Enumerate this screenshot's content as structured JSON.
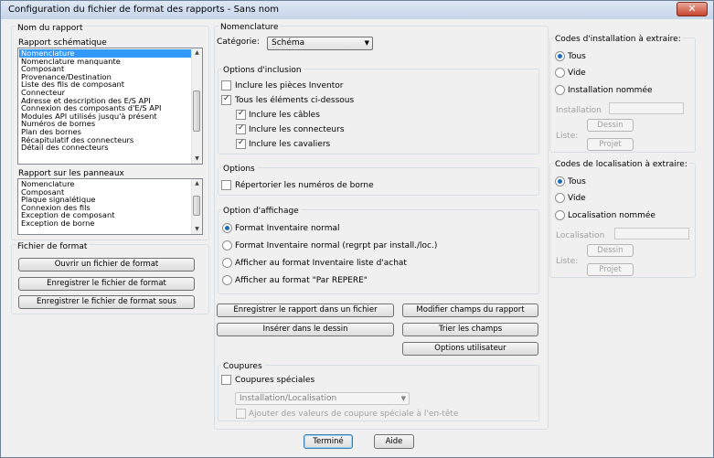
{
  "window": {
    "title": "Configuration du fichier de format des rapports - Sans nom",
    "close_glyph": "✕"
  },
  "left": {
    "name_group_label": "Nom du rapport",
    "schematic_label": "Rapport schématique",
    "schematic_items": [
      "Nomenclature",
      "Nomenclature manquante",
      "Composant",
      "Provenance/Destination",
      "Liste des fils de composant",
      "Connecteur",
      "Adresse et description des E/S API",
      "Connexion des composants d'E/S API",
      "Modules API utilisés jusqu'à présent",
      "Numéros de bornes",
      "Plan des bornes",
      "Récapitulatif des connecteurs",
      "Détail des connecteurs"
    ],
    "schematic_selected": "Nomenclature",
    "panel_label": "Rapport sur les panneaux",
    "panel_items": [
      "Nomenclature",
      "Composant",
      "Plaque signalétique",
      "Connexion des fils",
      "Exception de composant",
      "Exception de borne"
    ],
    "format_group_label": "Fichier de format",
    "open_button": "Ouvrir un fichier de format",
    "save_button": "Enregistrer le fichier de format",
    "save_as_button": "Enregistrer le fichier de format sous"
  },
  "middle": {
    "group_label": "Nomenclature",
    "category_label": "Catégorie:",
    "category_value": "Schéma",
    "inclusion_label": "Options d'inclusion",
    "inc_inventor": "Inclure les pièces Inventor",
    "inc_all": "Tous les éléments ci-dessous",
    "inc_cables": "Inclure les câbles",
    "inc_connectors": "Inclure les connecteurs",
    "inc_jumpers": "Inclure les cavaliers",
    "options_label": "Options",
    "list_terminals": "Répertorier les numéros de borne",
    "display_label": "Option d'affichage",
    "display_options": [
      "Format Inventaire normal",
      "Format Inventaire normal (regrpt par install./loc.)",
      "Afficher au format Inventaire liste d'achat",
      "Afficher au format \"Par REPERE\""
    ],
    "display_selected": 0,
    "save_report_button": "Enregistrer le rapport dans un fichier",
    "insert_button": "Insérer dans le dessin",
    "modify_fields_button": "Modifier champs du rapport",
    "sort_fields_button": "Trier les champs",
    "user_options_button": "Options utilisateur",
    "cuts_label": "Coupures",
    "special_cuts": "Coupures spéciales",
    "cuts_combo_value": "Installation/Localisation",
    "add_values": "Ajouter des valeurs de coupure spéciale à l'en-tête"
  },
  "right": {
    "install_label": "Codes d'installation à extraire:",
    "install_options": [
      "Tous",
      "Vide",
      "Installation nommée"
    ],
    "install_field_label": "Installation",
    "location_label": "Codes de localisation à extraire:",
    "location_options": [
      "Tous",
      "Vide",
      "Localisation nommée"
    ],
    "location_field_label": "Localisation",
    "list_label": "Liste:",
    "drawing_button": "Dessin",
    "project_button": "Projet"
  },
  "footer": {
    "done_button": "Terminé",
    "help_button": "Aide"
  },
  "icons": {
    "dropdown": "▼",
    "scroll_up": "▲",
    "scroll_down": "▼"
  }
}
